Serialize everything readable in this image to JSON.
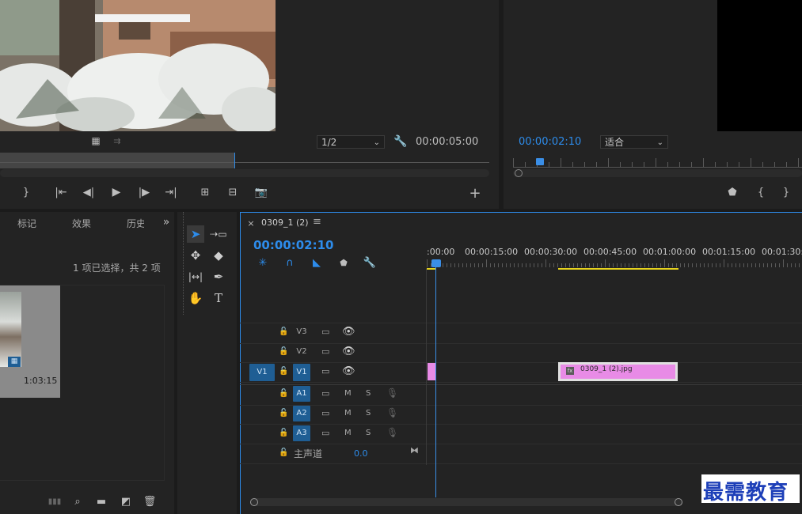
{
  "source_monitor": {
    "zoom_select": "1/2",
    "timecode": "00:00:05:00"
  },
  "program_monitor": {
    "timecode": "00:00:02:10",
    "fit_select": "适合"
  },
  "project_panel": {
    "tabs": [
      "标记",
      "效果",
      "历史"
    ],
    "selection_info": "1 项已选择，共 2 项",
    "clip_duration": "1:03:15"
  },
  "timeline": {
    "tab_close": "×",
    "sequence_name": "0309_1 (2)",
    "menu_icon": "≡",
    "timecode": "00:00:02:10",
    "ruler_labels": [
      ":00:00",
      "00:00:15:00",
      "00:00:30:00",
      "00:00:45:00",
      "00:01:00:00",
      "00:01:15:00",
      "00:01:30:0"
    ],
    "tracks": {
      "v3": "V3",
      "v2": "V2",
      "v1": "V1",
      "v1_source": "V1",
      "a1": "A1",
      "a2": "A2",
      "a3": "A3",
      "mute": "M",
      "solo": "S",
      "master_label": "主声道",
      "master_value": "0.0"
    },
    "clip": {
      "name": "0309_1 (2).jpg",
      "color": "#e88be6"
    }
  },
  "watermark": "最需教育",
  "colors": {
    "accent_blue": "#2d8ceb",
    "playhead": "#3a8ee6",
    "work_area": "#e6d31e",
    "clip": "#e88be6"
  }
}
